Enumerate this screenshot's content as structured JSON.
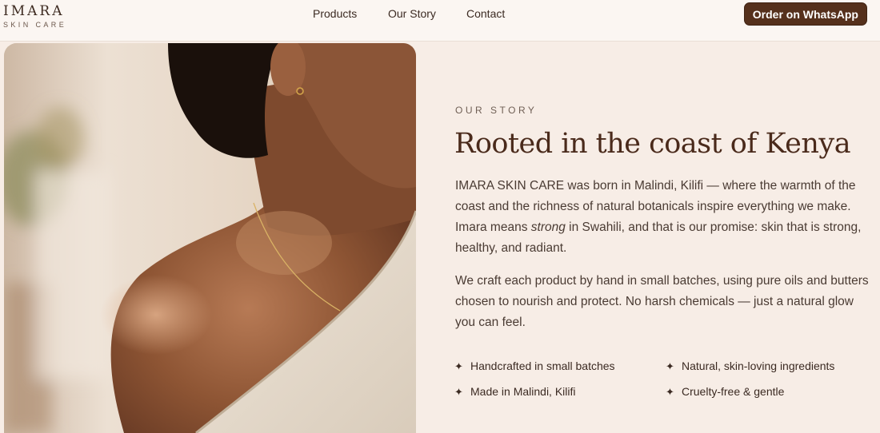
{
  "brand": {
    "name": "IMARA",
    "tagline": "SKIN CARE"
  },
  "nav": {
    "products": "Products",
    "story": "Our Story",
    "contact": "Contact"
  },
  "cta": {
    "label": "Order on WhatsApp"
  },
  "colors": {
    "accent": "#55301c",
    "background": "#f7ede6",
    "heading": "#4a2a1b"
  },
  "story": {
    "eyebrow": "OUR STORY",
    "title": "Rooted in the coast of Kenya",
    "p1_before": "IMARA SKIN CARE was born in Malindi, Kilifi — where the warmth of the coast and the richness of natural botanicals inspire everything we make. Imara means ",
    "p1_emph": "strong",
    "p1_after": " in Swahili, and that is our promise: skin that is strong, healthy, and radiant.",
    "p2": "We craft each product by hand in small batches, using pure oils and butters chosen to nourish and protect. No harsh chemicals — just a natural glow you can feel.",
    "features": [
      {
        "icon": "sparkle-icon",
        "label": "Handcrafted in small batches"
      },
      {
        "icon": "sparkle-icon",
        "label": "Natural, skin-loving ingredients"
      },
      {
        "icon": "sparkle-icon",
        "label": "Made in Malindi, Kilifi"
      },
      {
        "icon": "sparkle-icon",
        "label": "Cruelty-free & gentle"
      }
    ]
  }
}
